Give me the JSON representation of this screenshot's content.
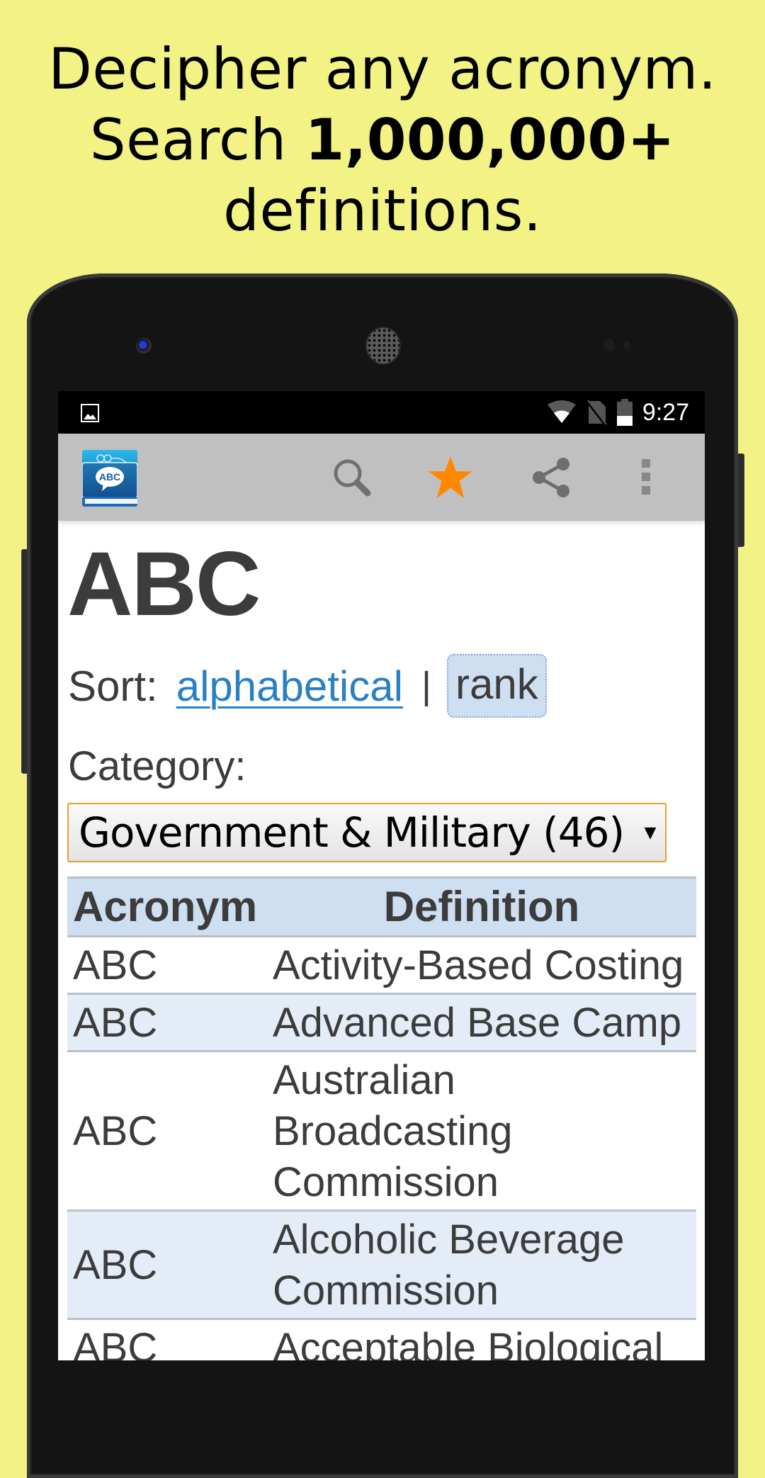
{
  "headline": {
    "line1": "Decipher any acronym.",
    "line2_prefix": "Search ",
    "line2_bold": "1,000,000+",
    "line3": "definitions."
  },
  "status_bar": {
    "left_icon": "image-notification-icon",
    "icons": [
      "wifi-icon",
      "no-sim-icon",
      "battery-icon"
    ],
    "time": "9:27"
  },
  "action_bar": {
    "logo": "app-logo-abc-book",
    "logo_text": "ABC",
    "actions": [
      {
        "name": "search",
        "icon": "search-icon"
      },
      {
        "name": "favorite",
        "icon": "star-icon",
        "color": "#FF8800"
      },
      {
        "name": "share",
        "icon": "share-icon"
      },
      {
        "name": "overflow-menu",
        "icon": "more-vert-icon"
      }
    ]
  },
  "page": {
    "title": "ABC",
    "sort": {
      "label": "Sort:",
      "options": [
        "alphabetical",
        "rank"
      ],
      "separator": "|",
      "active": "rank"
    },
    "category": {
      "label": "Category:",
      "selected": "Government & Military (46)"
    },
    "table": {
      "headers": [
        "Acronym",
        "Definition"
      ],
      "rows": [
        {
          "acronym": "ABC",
          "definition": "Activity-Based Costing"
        },
        {
          "acronym": "ABC",
          "definition": "Advanced Base Camp"
        },
        {
          "acronym": "ABC",
          "definition": "Australian Broadcasting Commission"
        },
        {
          "acronym": "ABC",
          "definition": "Alcoholic Beverage Commission"
        },
        {
          "acronym": "ABC",
          "definition": "Acceptable Biological"
        }
      ]
    }
  },
  "colors": {
    "background": "#F2F285",
    "action_bar": "#C0C0C0",
    "link": "#2A80C3",
    "star": "#FF8800",
    "table_header": "#CDDFF1",
    "row_alt": "#E4ECF7",
    "select_border": "#E0A22A"
  }
}
